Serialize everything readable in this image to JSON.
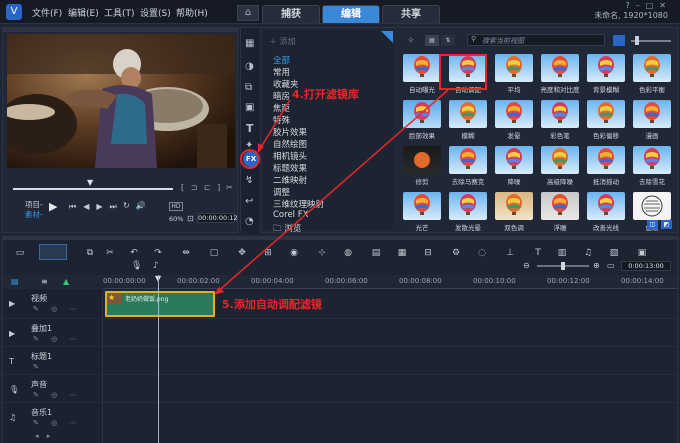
{
  "titlebar": {
    "menus": [
      "文件(F)",
      "编辑(E)",
      "工具(T)",
      "设置(S)",
      "帮助(H)"
    ],
    "tabs": [
      "捕获",
      "编辑",
      "共享"
    ],
    "active_tab": "编辑",
    "project_info": "未命名, 1920*1080"
  },
  "player": {
    "mode_labels": [
      "项目-",
      "素材-"
    ],
    "zoom": "60%",
    "timecode": "00:00:00:12",
    "playhead_marker": "▼"
  },
  "library": {
    "add_label": "添加",
    "search_placeholder": "搜索当前视图",
    "categories": [
      "全部",
      "常用",
      "收藏夹",
      "暗房",
      "焦距",
      "特殊",
      "胶片效果",
      "自然绘图",
      "相机镜头",
      "标题效果",
      "二维映射",
      "调整",
      "三维纹理映射",
      "Corel FX",
      "浏览"
    ],
    "active_category": "全部",
    "filters": [
      [
        "自动曝光",
        "自动调配",
        "平均",
        "亮度和对比度",
        "背景模糊",
        "色彩平衡"
      ],
      [
        "脸部效果",
        "模糊",
        "发晕",
        "彩色笔",
        "色彩偏移",
        "漫画"
      ],
      [
        "修剪",
        "去除马赛克",
        "降噪",
        "高级降噪",
        "抵消摇动",
        "去除雪花"
      ],
      [
        "光芒",
        "发散光晕",
        "双色调",
        "浮雕",
        "改善光线",
        "鱼眼"
      ]
    ],
    "highlighted_filter": "自动调配"
  },
  "timeline": {
    "ruler": [
      "00:00:00:00",
      "00:00:02:00",
      "00:00:04:00",
      "00:00:06:00",
      "00:00:08:00",
      "00:00:10:00",
      "00:00:12:00",
      "00:00:14:00"
    ],
    "zoom_timecode": "0:00:13:00",
    "tracks": [
      "视频",
      "叠加1",
      "标题1",
      "声音",
      "音乐1"
    ],
    "clip_name": "老奶奶做饭.png"
  },
  "annotations": {
    "step4": "4.打开滤镜库",
    "step5": "5.添加自动调配滤镜",
    "color": "#e8262a"
  }
}
